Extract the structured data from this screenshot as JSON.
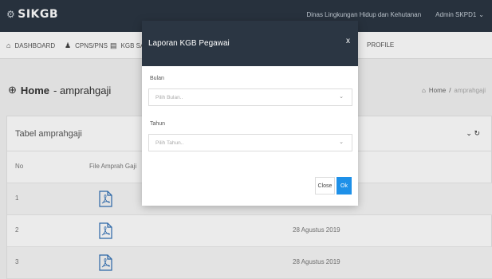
{
  "app": {
    "brand": "SIKGB",
    "brand_icon": "settings-icon"
  },
  "topbar": {
    "organization": "Dinas Lingkungan Hidup dan Kehutanan",
    "user": "Admin SKPD1",
    "user_caret": "⌄"
  },
  "nav": {
    "items": [
      {
        "label": "DASHBOARD",
        "icon": "home-icon"
      },
      {
        "label": "CPNS/PNS",
        "icon": "user-icon"
      },
      {
        "label": "KGB SAH",
        "icon": "document-icon"
      },
      {
        "label": "PROFILE",
        "icon": ""
      }
    ]
  },
  "page": {
    "title_strong": "Home",
    "title_sub": "- amprahgaji",
    "breadcrumb_home": "Home",
    "breadcrumb_sep": "/",
    "breadcrumb_current": "amprahgaji"
  },
  "card": {
    "title": "Tabel amprahgaji",
    "tools": "⌄ ↻"
  },
  "table": {
    "headers": [
      "No",
      "File Amprah Gaji"
    ],
    "rows": [
      {
        "no": "1",
        "date": ""
      },
      {
        "no": "2",
        "date": "28 Agustus 2019"
      },
      {
        "no": "3",
        "date": "28 Agustus 2019"
      }
    ]
  },
  "modal": {
    "title": "Laporan KGB Pegawai",
    "close_symbol": "x",
    "fields": [
      {
        "label": "Bulan",
        "placeholder": "Pilih Bulan.."
      },
      {
        "label": "Tahun",
        "placeholder": "Pilih Tahun.."
      }
    ],
    "close_button": "Close",
    "ok_button": "Ok"
  },
  "colors": {
    "header_bg": "#2b3643",
    "primary": "#1e90e8"
  }
}
